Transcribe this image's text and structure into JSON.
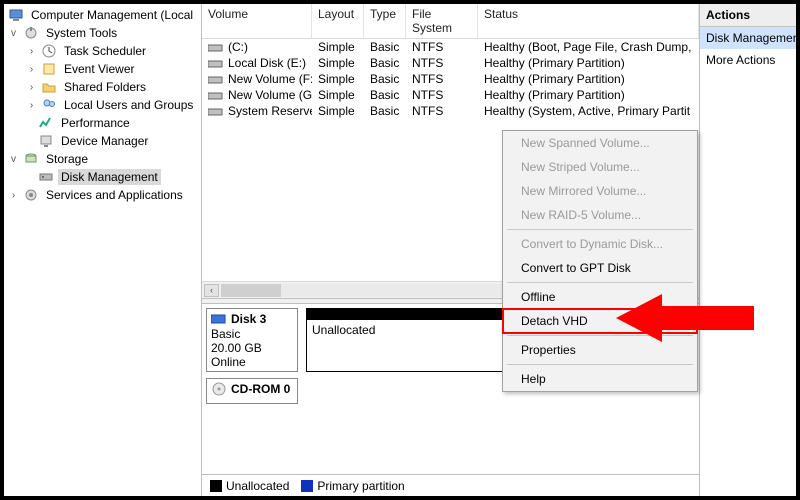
{
  "tree": {
    "root": "Computer Management (Local",
    "systools": "System Tools",
    "task": "Task Scheduler",
    "event": "Event Viewer",
    "shared": "Shared Folders",
    "users": "Local Users and Groups",
    "perf": "Performance",
    "devmgr": "Device Manager",
    "storage": "Storage",
    "diskmgmt": "Disk Management",
    "services": "Services and Applications"
  },
  "columns": {
    "vol": "Volume",
    "lay": "Layout",
    "typ": "Type",
    "fs": "File System",
    "st": "Status"
  },
  "rows": [
    {
      "vol": "(C:)",
      "lay": "Simple",
      "typ": "Basic",
      "fs": "NTFS",
      "st": "Healthy (Boot, Page File, Crash Dump,"
    },
    {
      "vol": "Local Disk (E:)",
      "lay": "Simple",
      "typ": "Basic",
      "fs": "NTFS",
      "st": "Healthy (Primary Partition)"
    },
    {
      "vol": "New Volume (F:)",
      "lay": "Simple",
      "typ": "Basic",
      "fs": "NTFS",
      "st": "Healthy (Primary Partition)"
    },
    {
      "vol": "New Volume (G:)",
      "lay": "Simple",
      "typ": "Basic",
      "fs": "NTFS",
      "st": "Healthy (Primary Partition)"
    },
    {
      "vol": "System Reserved",
      "lay": "Simple",
      "typ": "Basic",
      "fs": "NTFS",
      "st": "Healthy (System, Active, Primary Partit"
    }
  ],
  "ctx": {
    "spanned": "New Spanned Volume...",
    "striped": "New Striped Volume...",
    "mirrored": "New Mirrored Volume...",
    "raid5": "New RAID-5 Volume...",
    "dyn": "Convert to Dynamic Disk...",
    "gpt": "Convert to GPT Disk",
    "offline": "Offline",
    "detach": "Detach VHD",
    "props": "Properties",
    "help": "Help"
  },
  "disk3": {
    "title": "Disk 3",
    "type": "Basic",
    "size": "20.00 GB",
    "state": "Online",
    "part_label": "Unallocated"
  },
  "cdrom": {
    "title": "CD-ROM 0"
  },
  "legend": {
    "unalloc": "Unallocated",
    "primary": "Primary partition"
  },
  "actions": {
    "header": "Actions",
    "dm": "Disk Management",
    "more": "More Actions"
  }
}
